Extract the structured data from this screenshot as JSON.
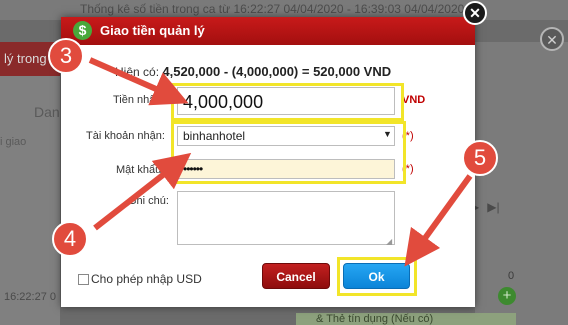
{
  "background": {
    "title": "Thống kê số tiền trong ca từ 16:22:27 04/04/2020 - 16:39:03 04/04/2020",
    "left_bar_text": "lý trong",
    "left_col_text": "Dan",
    "left_row_text": "i giao",
    "row_time": "16:22:27 0",
    "right_count": "0",
    "bottom_text": "& Thẻ tín dụng (Nếu có)"
  },
  "modal": {
    "title": "Giao tiền quản lý",
    "icon": "dollar-icon",
    "current_label": "Hiện có:",
    "current_formula": "4,520,000 - (4,000,000) = 520,000 VND",
    "amount_label": "Tiền nhận",
    "amount_value": "4,000,000",
    "currency": "VND",
    "account_label": "Tài khoản nhận:",
    "account_value": "binhanhotel",
    "password_label": "Mật khẩu",
    "password_value": "••••••",
    "note_label": "Ghi chú:",
    "required_mark": "(*)",
    "usd_checkbox_label": "Cho phép nhập USD",
    "cancel_label": "Cancel",
    "ok_label": "Ok"
  },
  "annotations": {
    "step3": "3",
    "step4": "4",
    "step5": "5",
    "highlight_color": "#f2e529",
    "marker_color": "#e14b3d"
  }
}
